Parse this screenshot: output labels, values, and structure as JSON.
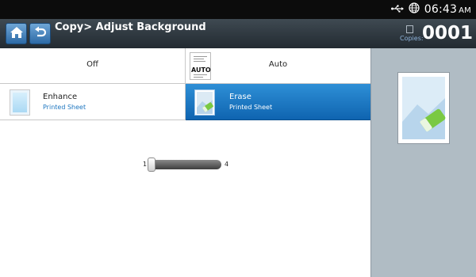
{
  "status_bar": {
    "time": "06:43",
    "ampm": "AM",
    "icons": [
      "usb-icon",
      "network-globe-icon"
    ]
  },
  "header": {
    "title": "Copy> Adjust Background",
    "copies_label": "Copies:",
    "copies_count": "0001",
    "icons": [
      "home-icon",
      "back-icon",
      "copies-icon"
    ]
  },
  "options": [
    {
      "label": "Off",
      "selected": false
    },
    {
      "label": "Auto",
      "icon_text": "AUTO",
      "selected": false
    },
    {
      "label": "Enhance",
      "sublabel": "Printed Sheet",
      "selected": false
    },
    {
      "label": "Erase",
      "sublabel": "Printed Sheet",
      "selected": true
    }
  ],
  "slider": {
    "min_label": "1",
    "max_label": "4",
    "value": 1,
    "min": 1,
    "max": 4
  },
  "colors": {
    "accent_blue": "#1a74c0",
    "header_dark": "#2a3238",
    "pane_gray": "#b0bcc4"
  },
  "preview": {
    "icon": "erase-preview-icon"
  }
}
